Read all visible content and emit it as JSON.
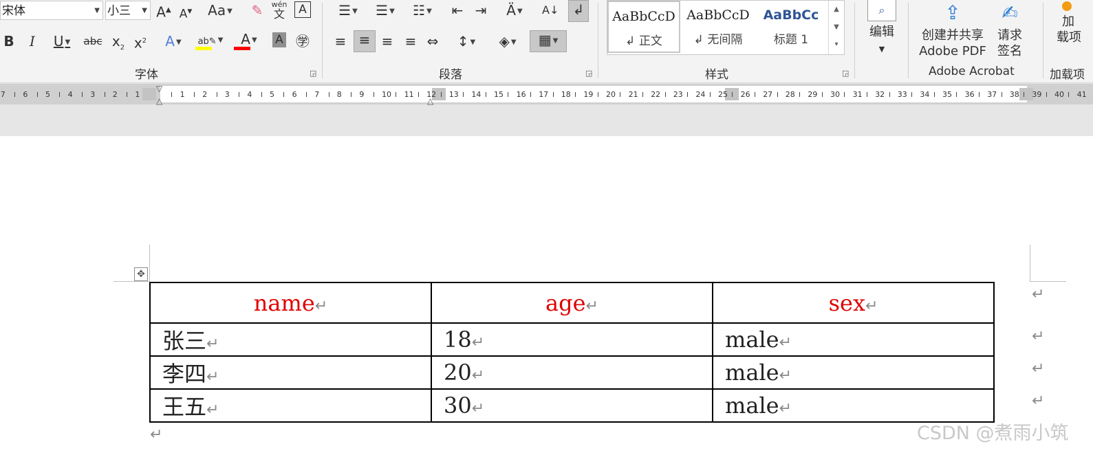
{
  "ribbon": {
    "font_name": "宋体",
    "font_size": "小三",
    "font_group_label": "字体",
    "paragraph_group_label": "段落",
    "styles_group_label": "样式",
    "acrobat_group_label": "Adobe Acrobat",
    "addins_group_label": "加载项",
    "change_case_label": "Aa",
    "phonetic_top": "wén",
    "phonetic_bottom": "文",
    "styles": [
      {
        "sample": "AaBbCcD",
        "name": "↲ 正文",
        "color": "#000000"
      },
      {
        "sample": "AaBbCcD",
        "name": "↲ 无间隔",
        "color": "#000000"
      },
      {
        "sample": "AaBbCc",
        "name": "标题 1",
        "color": "#2f5496"
      }
    ],
    "edit_label": "编辑",
    "create_pdf_label_1": "创建并共享",
    "create_pdf_label_2": "Adobe PDF",
    "sign_label_1": "请求",
    "sign_label_2": "签名",
    "addin_label_1": "加",
    "addin_label_2": "载项",
    "colors": {
      "highlight": "#ffff00",
      "font_color": "#ff0000",
      "style_heading": "#2f5496"
    }
  },
  "ruler": {
    "left_numbers": [
      "7",
      "6",
      "5",
      "4",
      "3",
      "2",
      "1"
    ],
    "right_numbers": [
      "1",
      "2",
      "3",
      "4",
      "5",
      "6",
      "7",
      "8",
      "9",
      "10",
      "11",
      "12",
      "13",
      "14",
      "15",
      "16",
      "17",
      "18",
      "19",
      "20",
      "21",
      "22",
      "23",
      "24",
      "25",
      "26",
      "27",
      "28",
      "29",
      "30",
      "31",
      "32",
      "33",
      "34",
      "35",
      "36",
      "37",
      "38",
      "39",
      "40",
      "41"
    ]
  },
  "table": {
    "headers": [
      "name",
      "age",
      "sex"
    ],
    "rows": [
      [
        "张三",
        "18",
        "male"
      ],
      [
        "李四",
        "20",
        "male"
      ],
      [
        "王五",
        "30",
        "male"
      ]
    ],
    "paragraph_mark": "↵",
    "header_color": "#e00000"
  },
  "watermark": "CSDN @煮雨小筑"
}
